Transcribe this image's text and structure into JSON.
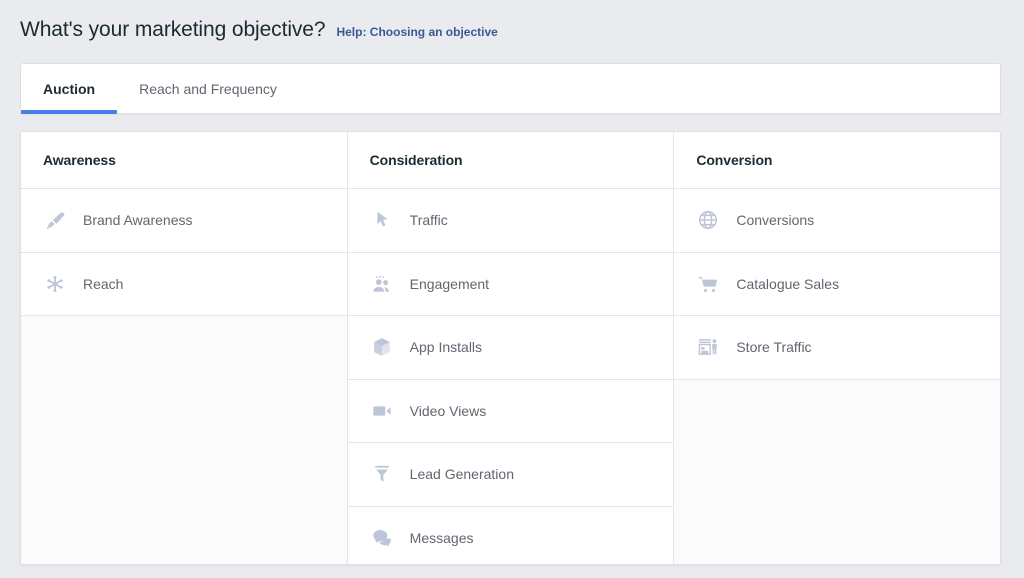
{
  "header": {
    "title": "What's your marketing objective?",
    "help_link": "Help: Choosing an objective"
  },
  "tabs": [
    {
      "label": "Auction",
      "active": true
    },
    {
      "label": "Reach and Frequency",
      "active": false
    }
  ],
  "colors": {
    "page_background": "#e9ebee",
    "card_background": "#ffffff",
    "active_tab_underline": "#4a7ce8",
    "link": "#3b5998",
    "header_text": "#1c2b33",
    "label_text": "#606770",
    "icon": "#bec5d9",
    "divider": "#e4e6eb"
  },
  "columns": [
    {
      "header": "Awareness",
      "items": [
        {
          "label": "Brand Awareness",
          "icon": "megaphone-icon"
        },
        {
          "label": "Reach",
          "icon": "starburst-icon"
        }
      ]
    },
    {
      "header": "Consideration",
      "items": [
        {
          "label": "Traffic",
          "icon": "cursor-arrow-icon"
        },
        {
          "label": "Engagement",
          "icon": "people-icon"
        },
        {
          "label": "App Installs",
          "icon": "cube-box-icon"
        },
        {
          "label": "Video Views",
          "icon": "video-camera-icon"
        },
        {
          "label": "Lead Generation",
          "icon": "funnel-icon"
        },
        {
          "label": "Messages",
          "icon": "speech-bubbles-icon"
        }
      ]
    },
    {
      "header": "Conversion",
      "items": [
        {
          "label": "Conversions",
          "icon": "globe-icon"
        },
        {
          "label": "Catalogue Sales",
          "icon": "shopping-cart-icon"
        },
        {
          "label": "Store Traffic",
          "icon": "storefront-icon"
        }
      ]
    }
  ]
}
